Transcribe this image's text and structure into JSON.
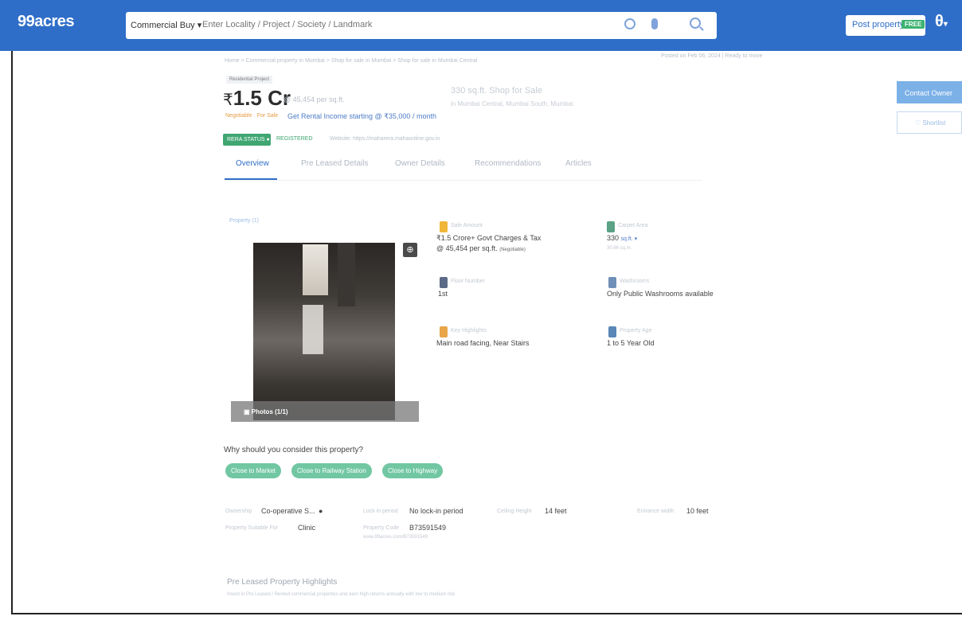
{
  "header": {
    "logo": "99acres",
    "category": "Commercial Buy",
    "search_placeholder": "Enter Locality / Project / Society / Landmark",
    "post_property": "Post property",
    "post_badge": "FREE"
  },
  "breadcrumb": "Home > Commercial property in Mumbai > Shop for sale in Mumbai > Shop for sale in Mumbai Central",
  "posted": "Posted on Feb 06, 2024  |  Ready to move",
  "tag": "Residential Project",
  "price": {
    "currency": "₹",
    "amount": "1.5 Cr",
    "per_sqft": "@ 45,454 per sq.ft."
  },
  "property_title": "330 sq.ft. Shop for Sale",
  "property_subtitle": "in Mumbai Central, Mumbai South, Mumbai",
  "negotiable": "Negotiable  ·  For Sale",
  "rental_income": "Get Rental Income starting @ ₹35,000 / month",
  "rera": {
    "label": "RERA STATUS",
    "number": "REGISTERED",
    "website": "Website: https://maharera.mahaonline.gov.in"
  },
  "tabs": [
    "Overview",
    "Pre Leased Details",
    "Owner Details",
    "Recommendations",
    "Articles"
  ],
  "photo": {
    "label": "Property (1)",
    "count": "Photos (1/1)"
  },
  "facts": {
    "price_label": "Sale Amount",
    "price_value": "₹1.5 Crore+ Govt Charges & Tax",
    "price_sub": "@ 45,454 per sq.ft.",
    "price_neg": "(Negotiable)",
    "area_label": "Carpet Area",
    "area_value": "330",
    "area_unit": "sq.ft.",
    "area_sub": "30.66 sq.m.",
    "floor_label": "Floor Number",
    "floor_value": "1st",
    "washroom_label": "Washrooms",
    "washroom_value": "Only Public Washrooms available",
    "highlight_label": "Key Highlights",
    "highlight_value": "Main road facing, Near Stairs",
    "age_label": "Property Age",
    "age_value": "1 to 5 Year Old"
  },
  "contact_button": "Contact Owner",
  "shortlist_button": "Shortlist",
  "why_consider": "Why should you consider this property?",
  "chips": [
    "Close to Market",
    "Close to Railway Station",
    "Close to Highway"
  ],
  "details": {
    "ownership_label": "Ownership",
    "ownership_value": "Co-operative S...",
    "lockin_label": "Lock in period",
    "lockin_value": "No lock-in period",
    "ceiling_label": "Ceiling Height",
    "ceiling_value": "14 feet",
    "entrance_label": "Entrance width",
    "entrance_value": "10 feet",
    "suitable_label": "Property Suitable For",
    "suitable_value": "Clinic",
    "code_label": "Property Code",
    "code_value": "B73591549",
    "code_sub": "www.99acres.com/B73591549"
  },
  "pre_leased": {
    "heading": "Pre Leased Property Highlights",
    "note": "Invest in Pre Leased / Rented commercial properties and earn high returns annually with low to medium risk"
  },
  "colors": {
    "brand": "#2f6ec8",
    "accent_green": "#3fa672",
    "chip": "#71c7a2"
  }
}
